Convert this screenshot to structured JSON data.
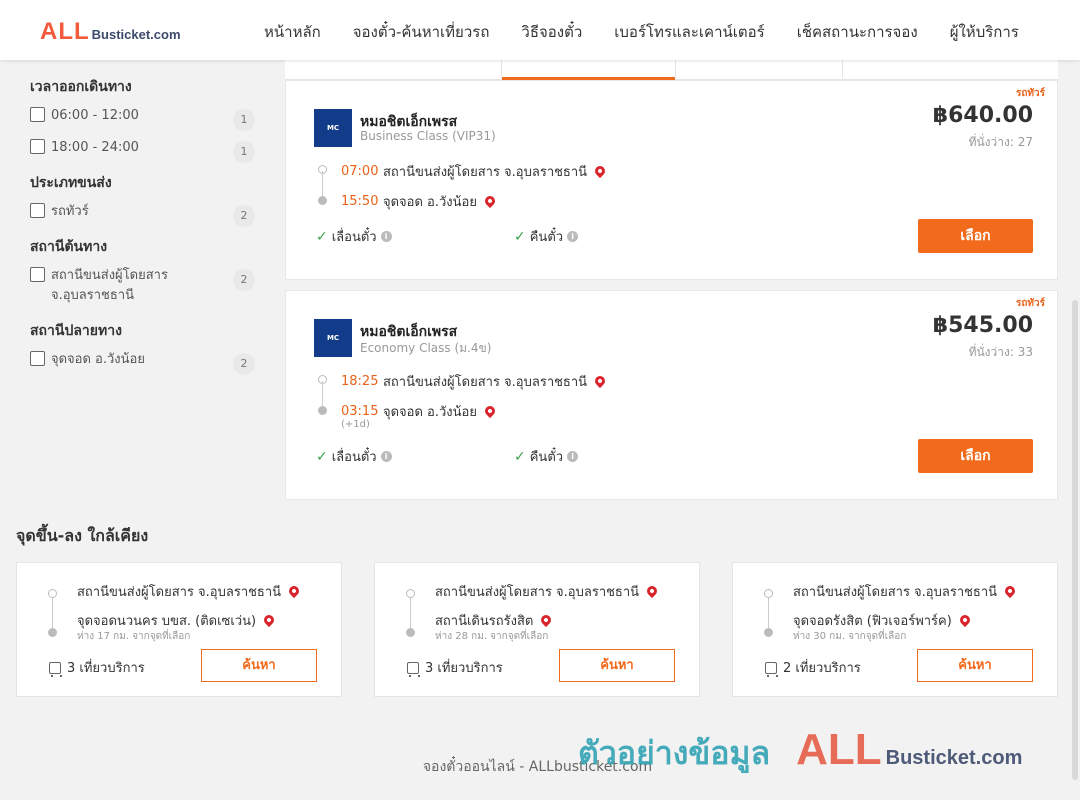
{
  "brand": {
    "logo_all": "ALL",
    "logo_rest": "Busticket.com"
  },
  "nav": [
    "หน้าหลัก",
    "จองตั๋ว-ค้นหาเที่ยวรถ",
    "วิธีจองตั๋ว",
    "เบอร์โทรและเคาน์เตอร์",
    "เช็คสถานะการจอง",
    "ผู้ให้บริการ"
  ],
  "filters": {
    "departure_time": {
      "title": "เวลาออกเดินทาง",
      "options": [
        {
          "label": "06:00 - 12:00",
          "count": "1"
        },
        {
          "label": "18:00 - 24:00",
          "count": "1"
        }
      ]
    },
    "transport_type": {
      "title": "ประเภทขนส่ง",
      "options": [
        {
          "label": "รถทัวร์",
          "count": "2"
        }
      ]
    },
    "origin": {
      "title": "สถานีต้นทาง",
      "options": [
        {
          "label": "สถานีขนส่งผู้โดยสาร จ.อุบลราชธานี",
          "count": "2"
        }
      ]
    },
    "destination": {
      "title": "สถานีปลายทาง",
      "options": [
        {
          "label": "จุดจอด อ.วังน้อย",
          "count": "2"
        }
      ]
    }
  },
  "trips": [
    {
      "tag": "รถทัวร์",
      "operator": "หมอชิตเอ็กเพรส",
      "logo_text": "MC EXPRESS",
      "class": "Business Class (VIP31)",
      "price": "฿640.00",
      "seats": "ที่นั่งว่าง: 27",
      "depart_time": "07:00",
      "depart_place": "สถานีขนส่งผู้โดยสาร จ.อุบลราชธานี",
      "arrive_time": "15:50",
      "arrive_place": "จุดจอด อ.วังน้อย",
      "next_day": "",
      "feature_1": "เลื่อนตั๋ว",
      "feature_2": "คืนตั๋ว",
      "button": "เลือก"
    },
    {
      "tag": "รถทัวร์",
      "operator": "หมอชิตเอ็กเพรส",
      "logo_text": "MC EXPRESS",
      "class": "Economy Class (ม.4ข)",
      "price": "฿545.00",
      "seats": "ที่นั่งว่าง: 33",
      "depart_time": "18:25",
      "depart_place": "สถานีขนส่งผู้โดยสาร จ.อุบลราชธานี",
      "arrive_time": "03:15",
      "arrive_place": "จุดจอด อ.วังน้อย",
      "next_day": "(+1d)",
      "feature_1": "เลื่อนตั๋ว",
      "feature_2": "คืนตั๋ว",
      "button": "เลือก"
    }
  ],
  "nearby": {
    "title": "จุดขึ้น-ลง ใกล้เคียง",
    "cards": [
      {
        "from": "สถานีขนส่งผู้โดยสาร จ.อุบลราชธานี",
        "to": "จุดจอดนวนคร บขส. (ติดเซเว่น)",
        "distance": "ห่าง 17 กม. จากจุดที่เลือก",
        "trips": "3 เที่ยวบริการ",
        "button": "ค้นหา"
      },
      {
        "from": "สถานีขนส่งผู้โดยสาร จ.อุบลราชธานี",
        "to": "สถานีเดินรถรังสิต",
        "distance": "ห่าง 28 กม. จากจุดที่เลือก",
        "trips": "3 เที่ยวบริการ",
        "button": "ค้นหา"
      },
      {
        "from": "สถานีขนส่งผู้โดยสาร จ.อุบลราชธานี",
        "to": "จุดจอดรังสิต (ฟิวเจอร์พาร์ค)",
        "distance": "ห่าง 30 กม. จากจุดที่เลือก",
        "trips": "2 เที่ยวบริการ",
        "button": "ค้นหา"
      }
    ]
  },
  "footer": {
    "text": "จองตั๋วออนไลน์ - ALLbusticket.com"
  },
  "watermark": {
    "thai": "ตัวอย่างข้อมูล",
    "all": "ALL",
    "rest": "Busticket.com"
  },
  "colors": {
    "accent": "#f26a1b",
    "pin": "#d9242b",
    "check": "#3aa34a",
    "brand_red": "#f25a3c",
    "brand_navy": "#3c4a6b"
  }
}
